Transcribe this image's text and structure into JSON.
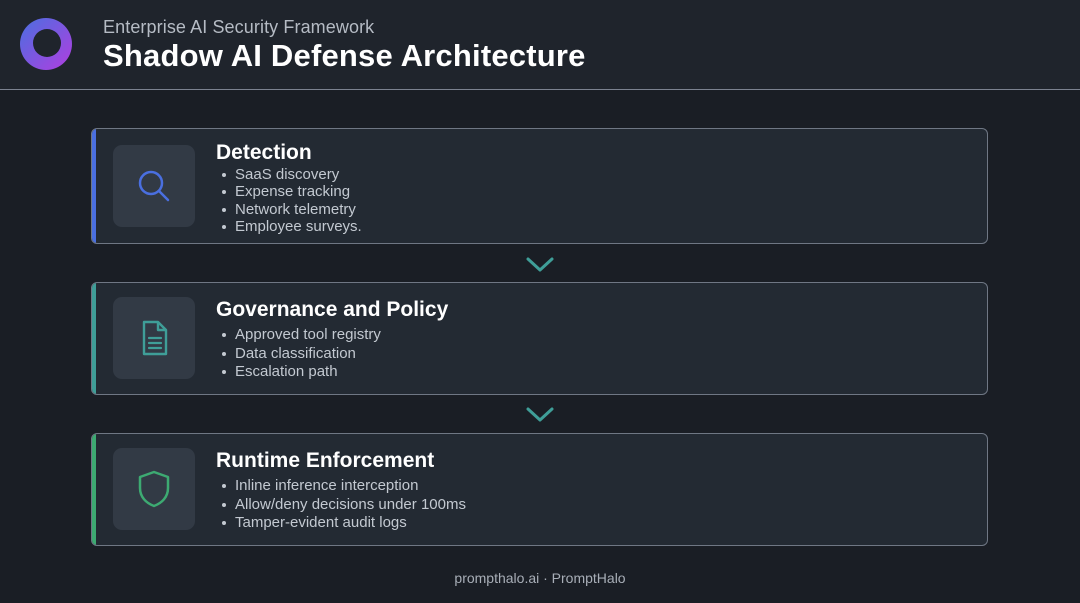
{
  "header": {
    "subtitle": "Enterprise AI Security Framework",
    "title": "Shadow AI Defense Architecture"
  },
  "cards": [
    {
      "title": "Detection",
      "icon": "search-icon",
      "accent": "#4a6fe0",
      "items": [
        "SaaS discovery",
        "Expense tracking",
        "Network telemetry",
        "Employee surveys."
      ]
    },
    {
      "title": "Governance and Policy",
      "icon": "document-icon",
      "accent": "#3f9e98",
      "items": [
        "Approved tool registry",
        "Data classification",
        "Escalation path"
      ]
    },
    {
      "title": "Runtime Enforcement",
      "icon": "shield-icon",
      "accent": "#3daa72",
      "items": [
        "Inline inference interception",
        "Allow/deny decisions under 100ms",
        "Tamper-evident audit logs"
      ]
    }
  ],
  "footer": "prompthalo.ai · PromptHalo",
  "colors": {
    "background": "#1a1e25",
    "card": "#232a33",
    "arrow": "#3f9e98",
    "logo_gradient": [
      "#4a6fe0",
      "#b03ee0"
    ]
  }
}
